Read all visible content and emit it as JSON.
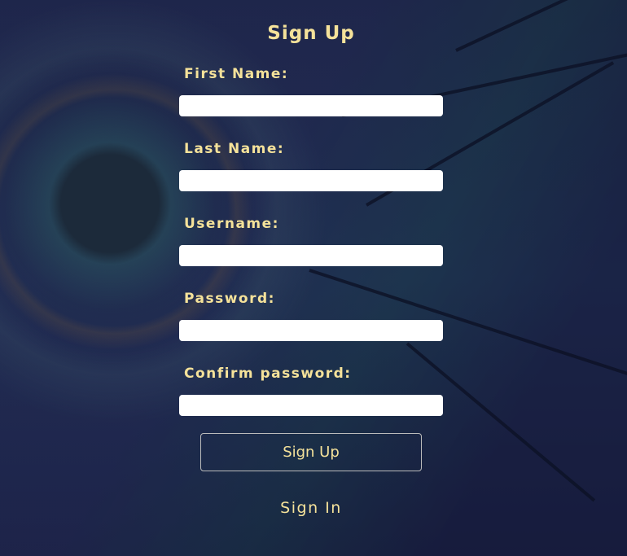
{
  "title": "Sign Up",
  "fields": [
    {
      "label": "First Name:",
      "value": ""
    },
    {
      "label": "Last Name:",
      "value": ""
    },
    {
      "label": "Username:",
      "value": ""
    },
    {
      "label": "Password:",
      "value": ""
    },
    {
      "label": "Confirm password:",
      "value": ""
    }
  ],
  "submit_label": "Sign Up",
  "signin_link": "Sign In",
  "colors": {
    "text": "#f5e29a",
    "input_bg": "#ffffff",
    "button_border": "#bbbbbb"
  }
}
